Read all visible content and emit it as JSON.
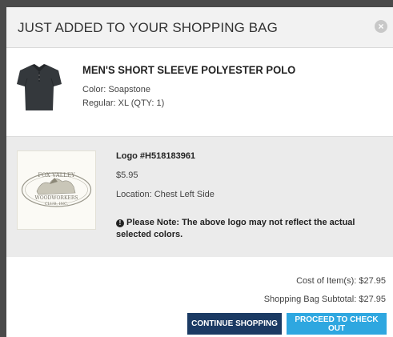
{
  "header": {
    "title": "JUST ADDED TO YOUR SHOPPING BAG",
    "close_glyph": "×"
  },
  "product": {
    "name": "MEN'S SHORT SLEEVE POLYESTER POLO",
    "color": "Color: Soapstone",
    "size": "Regular: XL (QTY: 1)",
    "image_icon": "polo-shirt"
  },
  "logo": {
    "name": "Logo #H518183961",
    "price": "$5.95",
    "location": "Location: Chest Left Side",
    "note_icon": "!",
    "note": "Please Note: The above logo may not reflect the actual selected colors.",
    "image_text_top": "FOX VALLEY",
    "image_text_bottom": "WOODWORKERS",
    "image_text_sub": "CLUB, INC."
  },
  "totals": {
    "cost": "Cost of Item(s): $27.95",
    "subtotal": "Shopping Bag Subtotal: $27.95"
  },
  "buttons": {
    "continue": "CONTINUE SHOPPING",
    "checkout": "PROCEED TO CHECK OUT"
  },
  "colors": {
    "continue_bg": "#1b3a63",
    "checkout_bg": "#2ea7e0",
    "logo_section_bg": "#ebebeb"
  }
}
